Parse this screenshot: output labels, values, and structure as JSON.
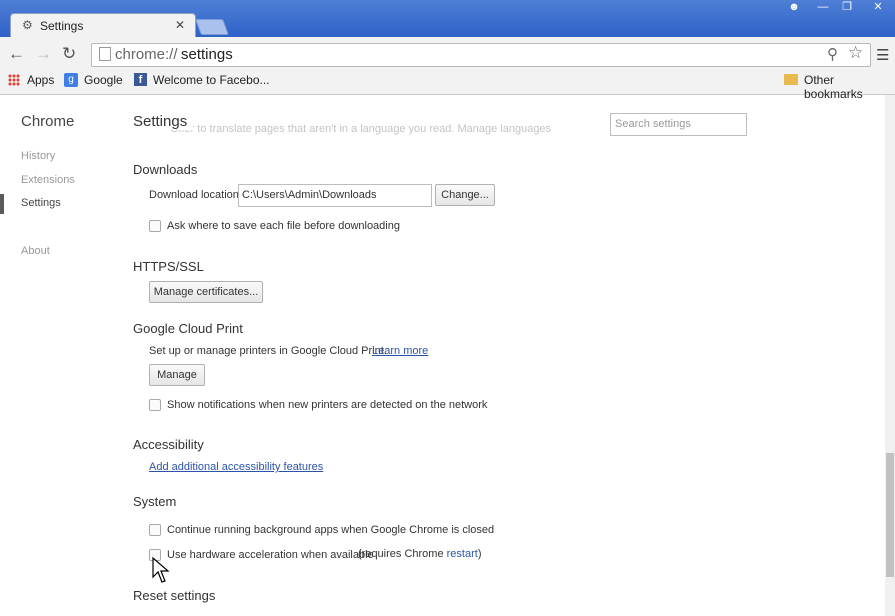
{
  "browser": {
    "tab_title": "Settings",
    "url_scheme": "chrome://",
    "url_path": "settings",
    "bookmarks": [
      "Apps",
      "Google",
      "Welcome to Facebo..."
    ],
    "other_bookmarks": "Other bookmarks"
  },
  "sidebar": {
    "title": "Chrome",
    "items": [
      "History",
      "Extensions",
      "Settings",
      "About"
    ],
    "active": "Settings"
  },
  "page": {
    "title": "Settings",
    "search_placeholder": "Search settings",
    "faded_text": "Offer to translate pages that aren't in a language you read. Manage languages"
  },
  "downloads": {
    "heading": "Downloads",
    "location_label": "Download location:",
    "location_value": "C:\\Users\\Admin\\Downloads",
    "change_button": "Change...",
    "ask_label": "Ask where to save each file before downloading"
  },
  "https": {
    "heading": "HTTPS/SSL",
    "manage_button": "Manage certificates..."
  },
  "cloud_print": {
    "heading": "Google Cloud Print",
    "description": "Set up or manage printers in Google Cloud Print.",
    "learn_more": "Learn more",
    "manage_button": "Manage",
    "notify_label": "Show notifications when new printers are detected on the network"
  },
  "accessibility": {
    "heading": "Accessibility",
    "link": "Add additional accessibility features"
  },
  "system": {
    "heading": "System",
    "background_label": "Continue running background apps when Google Chrome is closed",
    "hw_label": "Use hardware acceleration when available",
    "hw_note_prefix": "(requires Chrome ",
    "hw_note_link": "restart",
    "hw_note_suffix": ")"
  },
  "reset": {
    "heading": "Reset settings"
  }
}
